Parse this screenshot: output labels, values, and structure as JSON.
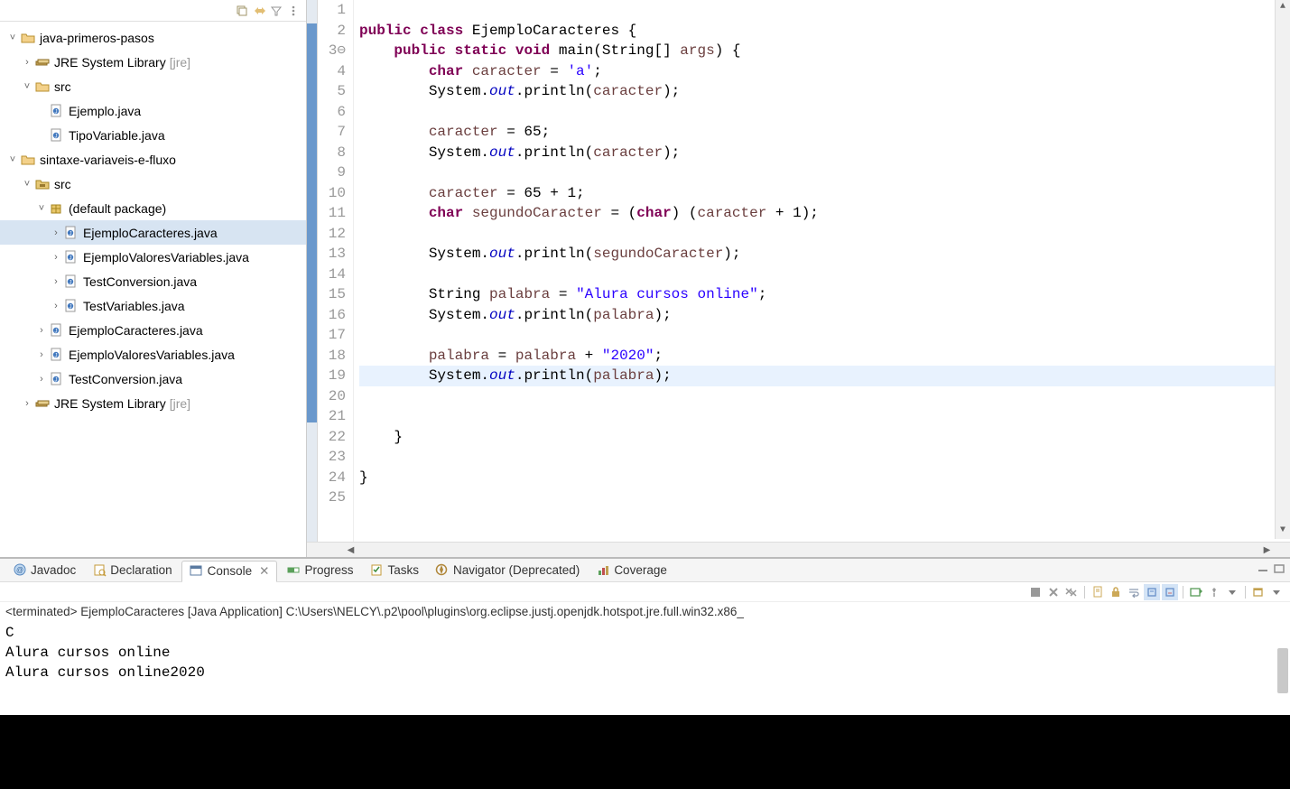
{
  "sidebar": {
    "projects": [
      {
        "name": "java-primeros-pasos",
        "type": "project",
        "expanded": true,
        "indent": 0
      },
      {
        "name": "JRE System Library",
        "suffix": "[jre]",
        "type": "jre",
        "indent": 1
      },
      {
        "name": "src",
        "type": "folder",
        "expanded": true,
        "indent": 1
      },
      {
        "name": "Ejemplo.java",
        "type": "java",
        "indent": 2
      },
      {
        "name": "TipoVariable.java",
        "type": "java",
        "indent": 2
      },
      {
        "name": "sintaxe-variaveis-e-fluxo",
        "type": "project",
        "expanded": true,
        "indent": 0
      },
      {
        "name": "src",
        "type": "srcfolder",
        "expanded": true,
        "indent": 1
      },
      {
        "name": "(default package)",
        "type": "package",
        "expanded": true,
        "indent": 2
      },
      {
        "name": "EjemploCaracteres.java",
        "type": "java",
        "selected": true,
        "indent": 3
      },
      {
        "name": "EjemploValoresVariables.java",
        "type": "java",
        "indent": 3
      },
      {
        "name": "TestConversion.java",
        "type": "java",
        "indent": 3
      },
      {
        "name": "TestVariables.java",
        "type": "java",
        "indent": 3
      },
      {
        "name": "EjemploCaracteres.java",
        "type": "java",
        "indent": 2
      },
      {
        "name": "EjemploValoresVariables.java",
        "type": "java",
        "indent": 2
      },
      {
        "name": "TestConversion.java",
        "type": "java",
        "indent": 2
      },
      {
        "name": "JRE System Library",
        "suffix": "[jre]",
        "type": "jre",
        "indent": 1
      }
    ]
  },
  "editor": {
    "lines": [
      {
        "n": "1",
        "raw": ""
      },
      {
        "n": "2",
        "raw": "<span class='kw'>public</span> <span class='kw'>class</span> EjemploCaracteres {"
      },
      {
        "n": "3",
        "suffix": "⊖",
        "raw": "    <span class='kw'>public</span> <span class='kw'>static</span> <span class='kw'>void</span> main(String[] <span class='var'>args</span>) {"
      },
      {
        "n": "4",
        "raw": "        <span class='kw'>char</span> <span class='var'>caracter</span> = <span class='str'>'a'</span>;"
      },
      {
        "n": "5",
        "raw": "        System.<span class='field'>out</span>.println(<span class='var'>caracter</span>);"
      },
      {
        "n": "6",
        "raw": ""
      },
      {
        "n": "7",
        "raw": "        <span class='var'>caracter</span> = 65;"
      },
      {
        "n": "8",
        "raw": "        System.<span class='field'>out</span>.println(<span class='var'>caracter</span>);"
      },
      {
        "n": "9",
        "raw": ""
      },
      {
        "n": "10",
        "raw": "        <span class='var'>caracter</span> = 65 + 1;"
      },
      {
        "n": "11",
        "raw": "        <span class='kw'>char</span> <span class='var'>segundoCaracter</span> = (<span class='kw'>char</span>) (<span class='var'>caracter</span> + 1);"
      },
      {
        "n": "12",
        "raw": ""
      },
      {
        "n": "13",
        "raw": "        System.<span class='field'>out</span>.println(<span class='var'>segundoCaracter</span>);"
      },
      {
        "n": "14",
        "raw": ""
      },
      {
        "n": "15",
        "raw": "        String <span class='var'>palabra</span> = <span class='str'>\"Alura cursos online\"</span>;"
      },
      {
        "n": "16",
        "raw": "        System.<span class='field'>out</span>.println(<span class='var'>palabra</span>);"
      },
      {
        "n": "17",
        "raw": ""
      },
      {
        "n": "18",
        "raw": "        <span class='var'>palabra</span> = <span class='var'>palabra</span> + <span class='str'>\"2020\"</span>;"
      },
      {
        "n": "19",
        "hl": true,
        "raw": "        System.<span class='field'>out</span>.println(<span class='var'>palabra</span>);"
      },
      {
        "n": "20",
        "raw": ""
      },
      {
        "n": "21",
        "raw": ""
      },
      {
        "n": "22",
        "raw": "    }"
      },
      {
        "n": "23",
        "raw": ""
      },
      {
        "n": "24",
        "raw": "}"
      },
      {
        "n": "25",
        "raw": ""
      }
    ]
  },
  "bottom": {
    "tabs": [
      {
        "label": "Javadoc",
        "icon": "javadoc"
      },
      {
        "label": "Declaration",
        "icon": "decl"
      },
      {
        "label": "Console",
        "icon": "console",
        "active": true,
        "closable": true
      },
      {
        "label": "Progress",
        "icon": "progress"
      },
      {
        "label": "Tasks",
        "icon": "tasks"
      },
      {
        "label": "Navigator (Deprecated)",
        "icon": "nav"
      },
      {
        "label": "Coverage",
        "icon": "cov"
      }
    ],
    "status": "<terminated> EjemploCaracteres [Java Application] C:\\Users\\NELCY\\.p2\\pool\\plugins\\org.eclipse.justj.openjdk.hotspot.jre.full.win32.x86_",
    "output": [
      "C",
      "Alura cursos online",
      "Alura cursos online2020"
    ]
  }
}
